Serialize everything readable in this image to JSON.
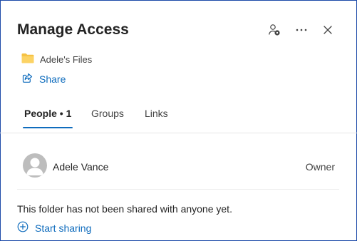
{
  "header": {
    "title": "Manage Access",
    "icons": [
      "people-settings-icon",
      "more-icon",
      "close-icon"
    ]
  },
  "folder": {
    "name": "Adele's Files",
    "icon": "folder-icon",
    "icon_color": "#f3c13a"
  },
  "share": {
    "label": "Share",
    "icon": "share-icon"
  },
  "tabs": [
    {
      "label": "People • 1",
      "active": true
    },
    {
      "label": "Groups",
      "active": false
    },
    {
      "label": "Links",
      "active": false
    }
  ],
  "people": [
    {
      "name": "Adele Vance",
      "role": "Owner"
    }
  ],
  "empty_message": "This folder has not been shared with anyone yet.",
  "start_sharing": {
    "label": "Start sharing",
    "icon": "add-circle-icon"
  },
  "colors": {
    "accent": "#0f6cbd",
    "frame_border": "#1d4ba8"
  }
}
